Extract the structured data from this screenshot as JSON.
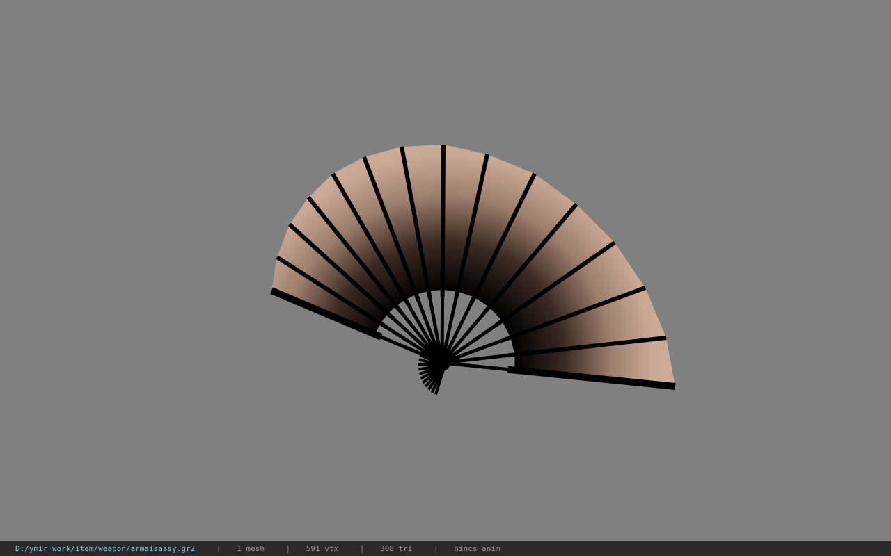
{
  "viewer": {
    "background_color": "#808080",
    "model": "folding fan",
    "model_colors": {
      "paper_light": "#c9a692",
      "paper_dark": "#000000",
      "ribs": "#000000"
    }
  },
  "status_bar": {
    "file_path": "D:/ymir work/item/weapon/armaisassy.gr2",
    "separator": "|",
    "mesh_count": "1 mesh",
    "vertex_count": "591 vtx",
    "triangle_count": "308 tri",
    "animation": "nincs anim"
  }
}
